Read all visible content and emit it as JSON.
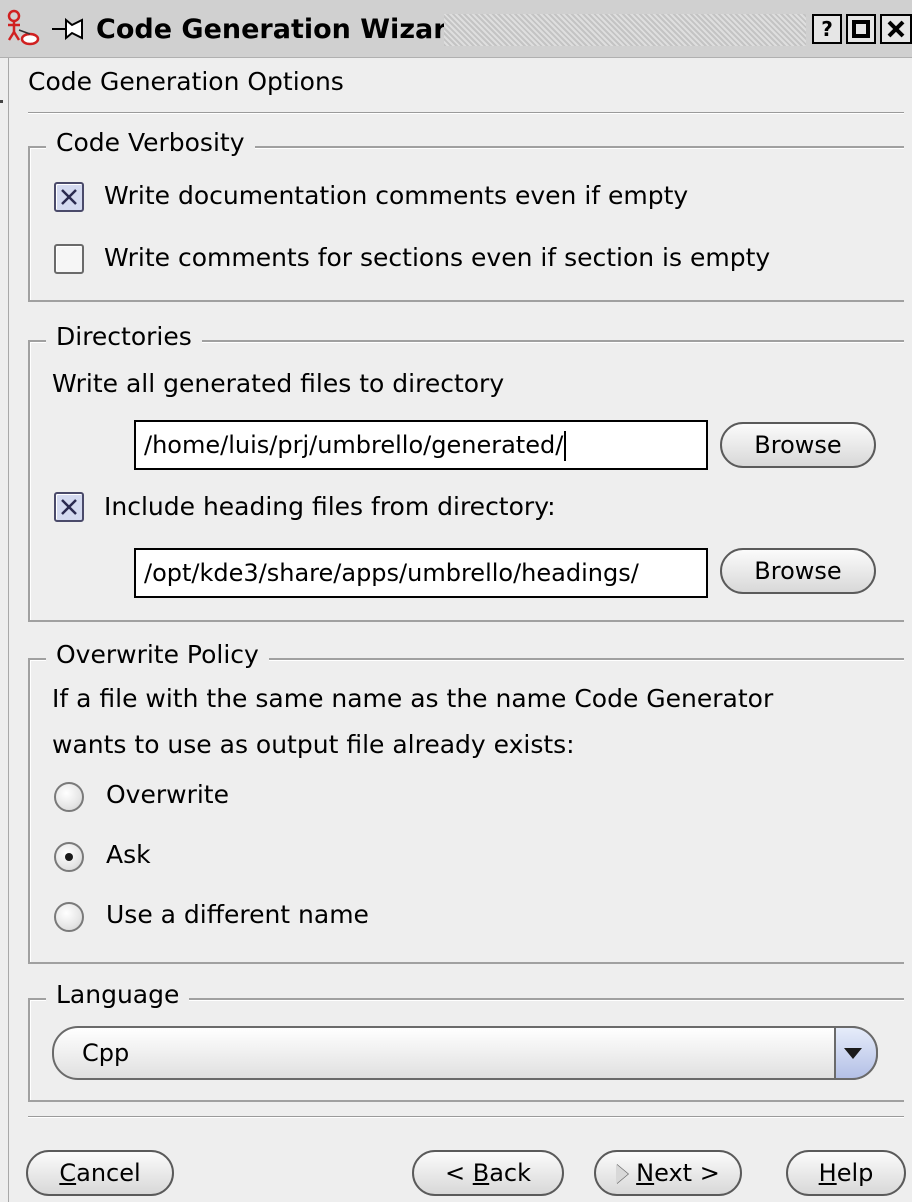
{
  "window": {
    "title": "Code Generation Wizard",
    "buttons": {
      "help": "?",
      "maximize": "□",
      "close": "×"
    }
  },
  "page": {
    "heading": "Code Generation Options"
  },
  "verbosity": {
    "title": "Code Verbosity",
    "doc_comments": {
      "label": "Write documentation comments even if empty",
      "checked": true
    },
    "section_comments": {
      "label": "Write comments for sections even if section is empty",
      "checked": false
    }
  },
  "directories": {
    "title": "Directories",
    "output_label": "Write all generated files to directory",
    "output_path": "/home/luis/prj/umbrello/generated/",
    "browse_label": "Browse",
    "include_headings": {
      "label": "Include heading files from directory:",
      "checked": true
    },
    "headings_path": "/opt/kde3/share/apps/umbrello/headings/"
  },
  "overwrite": {
    "title": "Overwrite Policy",
    "description_line1": "If a file with the same name as the name Code Generator",
    "description_line2": "wants to use as output file already exists:",
    "options": [
      {
        "label": "Overwrite",
        "selected": false
      },
      {
        "label": "Ask",
        "selected": true
      },
      {
        "label": "Use a different name",
        "selected": false
      }
    ]
  },
  "language": {
    "title": "Language",
    "selected": "Cpp"
  },
  "footer": {
    "cancel": {
      "mnemonic": "C",
      "rest": "ancel"
    },
    "back": {
      "prefix": "< ",
      "mnemonic": "B",
      "rest": "ack"
    },
    "next": {
      "mnemonic": "N",
      "rest": "ext >"
    },
    "help": {
      "mnemonic": "H",
      "rest": "elp"
    }
  },
  "icons": {
    "app": "umbrello-actor-icon",
    "window_menu": "pin-icon"
  }
}
